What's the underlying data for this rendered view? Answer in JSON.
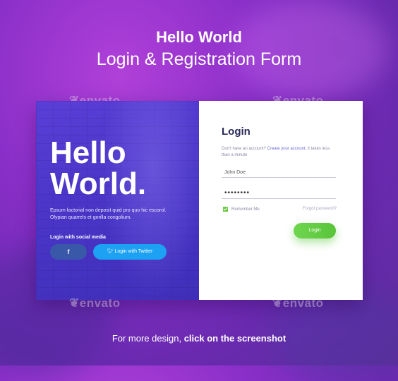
{
  "header": {
    "line1": "Hello World",
    "line2": "Login & Registration Form"
  },
  "watermark": "envato",
  "left": {
    "headline_1": "Hello",
    "headline_2": "World.",
    "description": "Epsum factorial non deposit quid pro quo hic escorol. Olypian quarrels et gorilla congolium.",
    "social_label": "Login with social media",
    "facebook_glyph": "f",
    "twitter_label": "Login with Twitter"
  },
  "form": {
    "title": "Login",
    "hint_text": "Don't have an account?",
    "hint_link": "Create your account",
    "hint_tail": ", it takes less than a minute",
    "username_value": "John Doe",
    "password_value": "••••••••",
    "remember_label": "Remember Me",
    "forgot_label": "Forgot password?",
    "login_button": "Login"
  },
  "footer": {
    "prefix": "For more design, ",
    "emphasis": "click on the screenshot"
  },
  "colors": {
    "accent_green": "#6cc644",
    "twitter": "#1da1f2",
    "facebook": "#3a58a8",
    "panel_purple": "#4a35c8"
  }
}
